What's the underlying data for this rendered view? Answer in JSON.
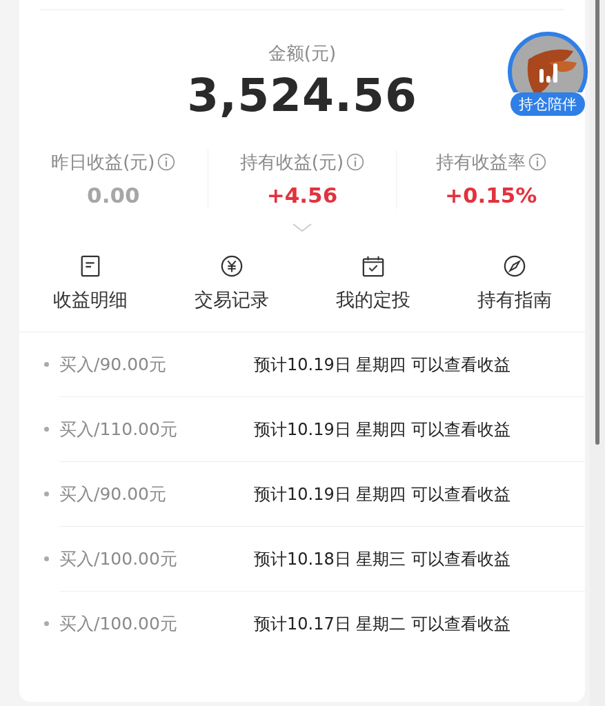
{
  "summary": {
    "label": "金额(元)",
    "amount": "3,524.56"
  },
  "badge": {
    "label": "持仓陪伴"
  },
  "stats": [
    {
      "label": "昨日收益(元)",
      "value": "0.00",
      "color": "#a6a6a6"
    },
    {
      "label": "持有收益(元)",
      "value": "+4.56",
      "color": "#e2323e"
    },
    {
      "label": "持有收益率",
      "value": "+0.15%",
      "color": "#e2323e"
    }
  ],
  "actions": [
    {
      "label": "收益明细",
      "kind": "document"
    },
    {
      "label": "交易记录",
      "kind": "yen"
    },
    {
      "label": "我的定投",
      "kind": "calendar"
    },
    {
      "label": "持有指南",
      "kind": "compass"
    }
  ],
  "records": [
    {
      "title": "买入/90.00元",
      "note": "预计10.19日 星期四 可以查看收益"
    },
    {
      "title": "买入/110.00元",
      "note": "预计10.19日 星期四 可以查看收益"
    },
    {
      "title": "买入/90.00元",
      "note": "预计10.19日 星期四 可以查看收益"
    },
    {
      "title": "买入/100.00元",
      "note": "预计10.18日 星期三 可以查看收益"
    },
    {
      "title": "买入/100.00元",
      "note": "预计10.17日 星期二 可以查看收益"
    }
  ]
}
